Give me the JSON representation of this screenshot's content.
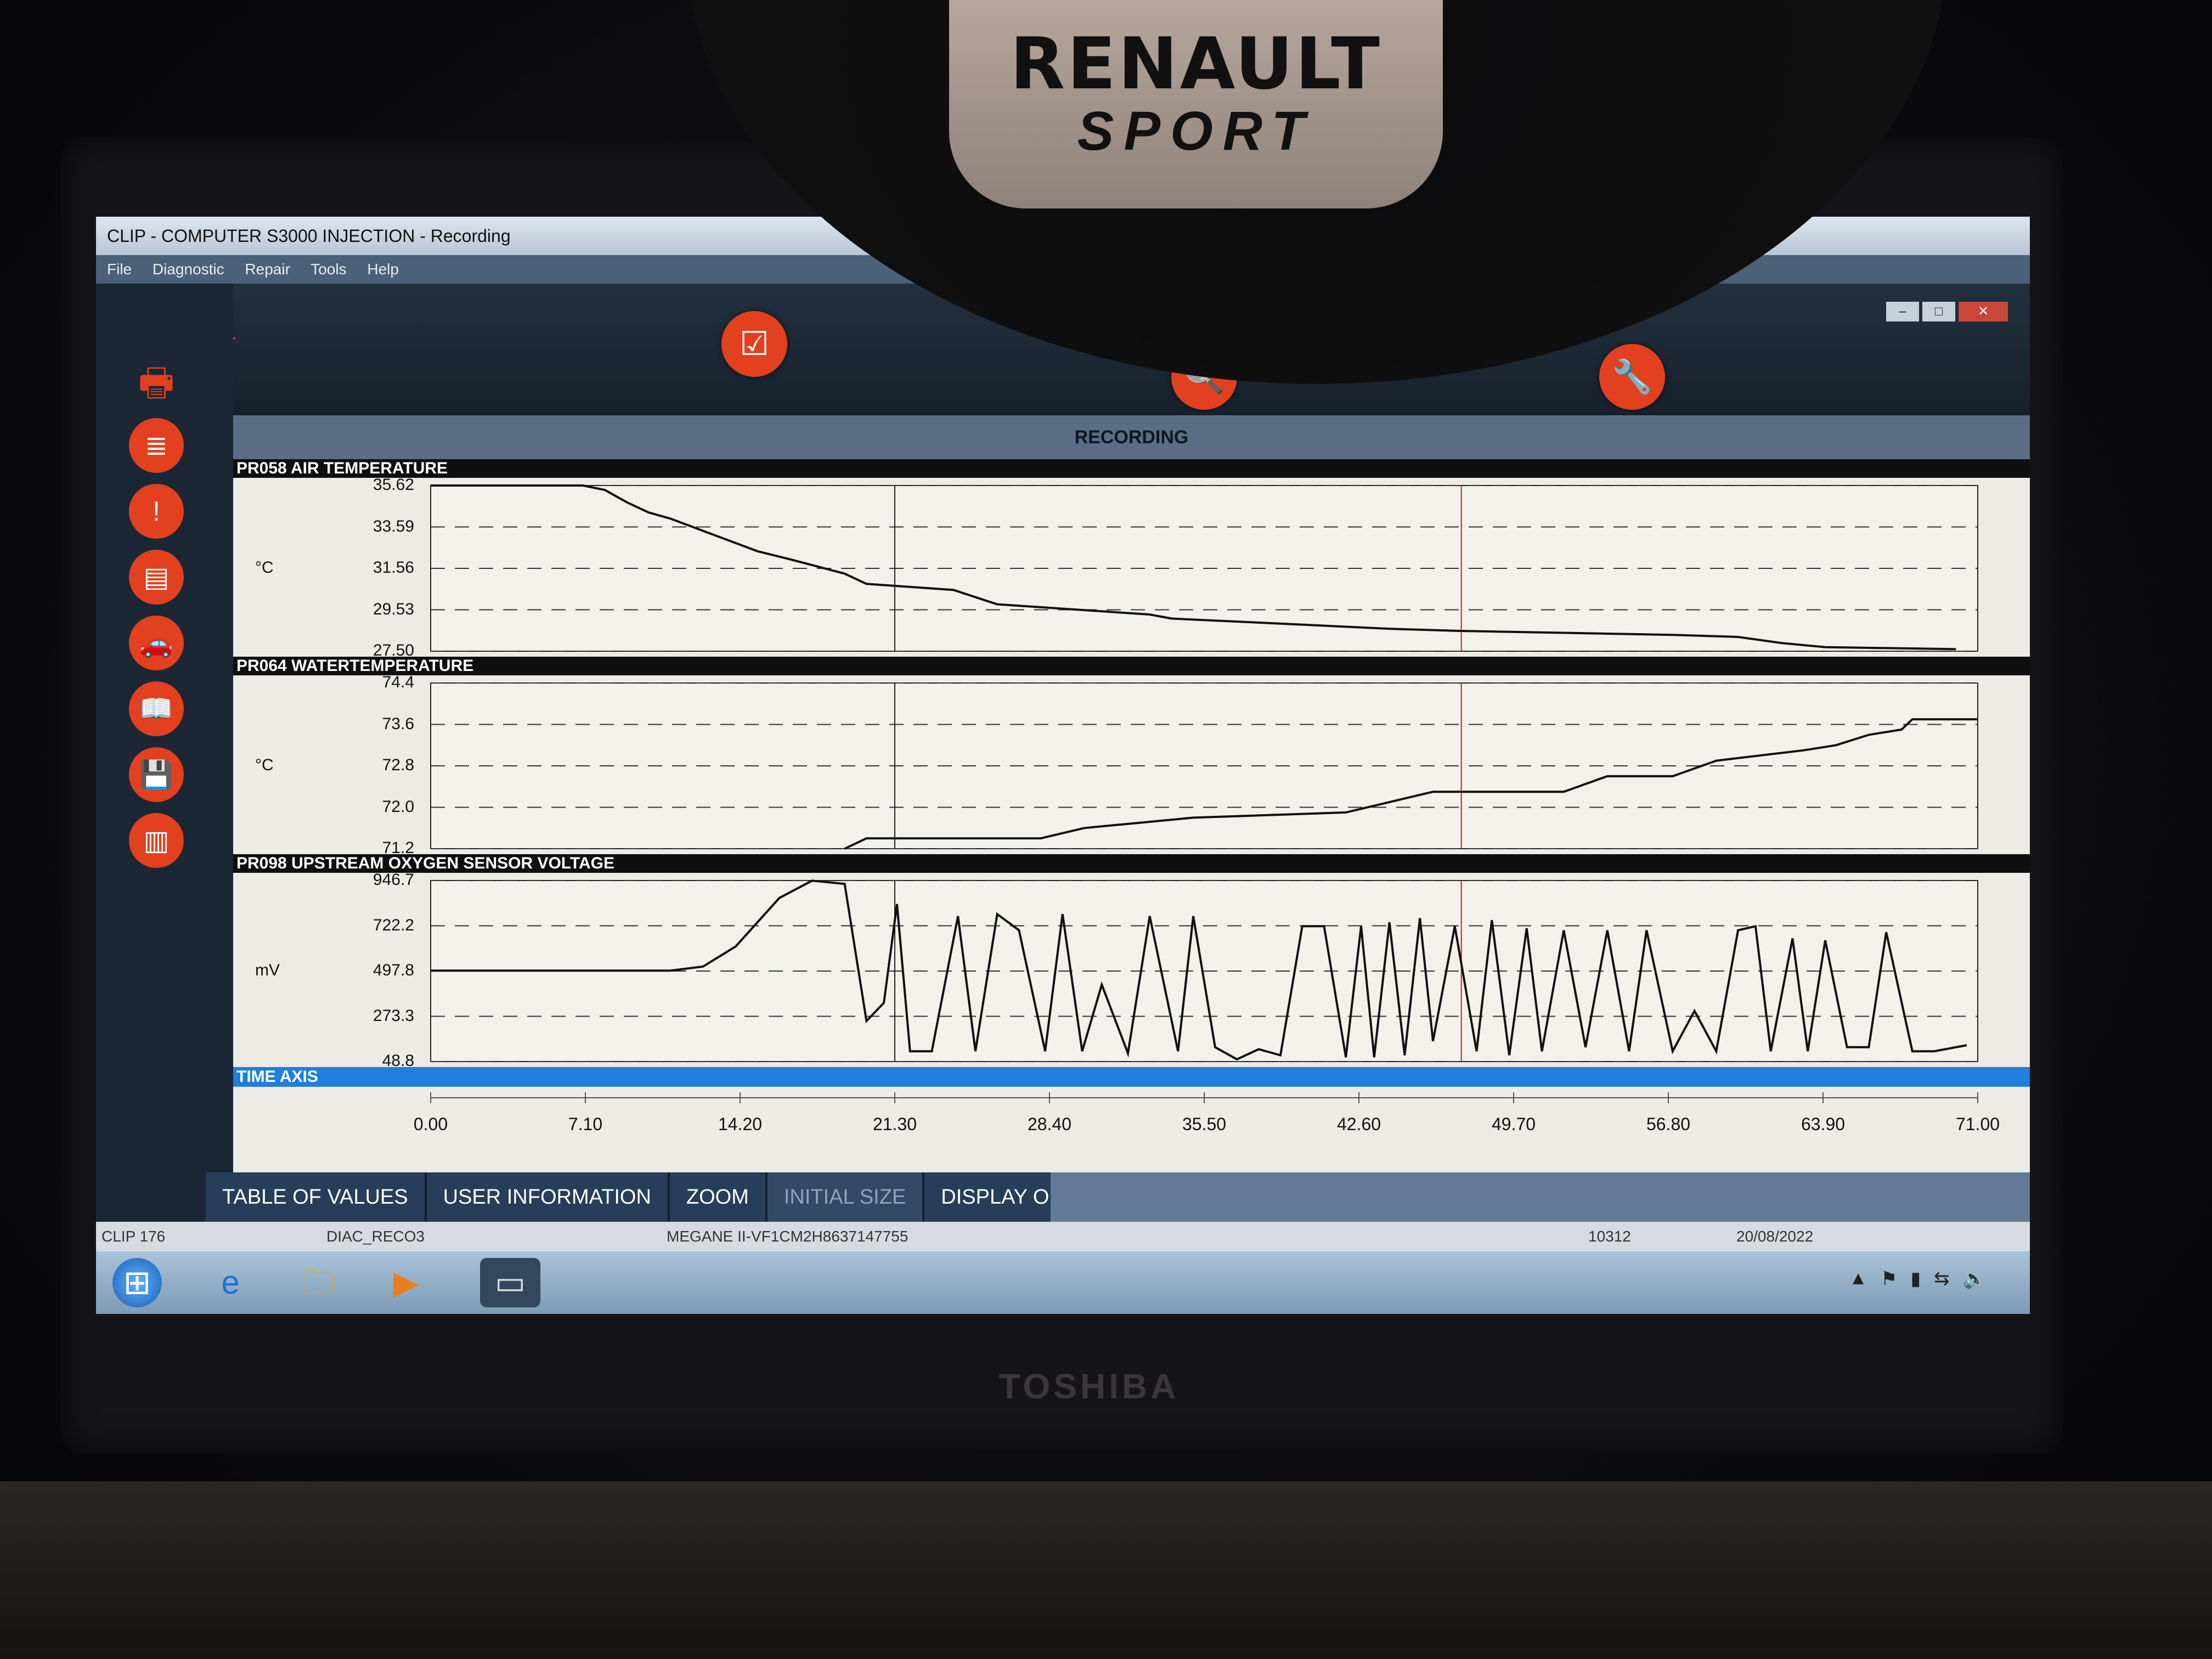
{
  "window": {
    "title": "CLIP - COMPUTER S3000 INJECTION - Recording",
    "menu": [
      "File",
      "Diagnostic",
      "Repair",
      "Tools",
      "Help"
    ],
    "controls": {
      "minimize": "–",
      "maximize": "□",
      "close": "✕"
    }
  },
  "wheel": {
    "brand_line1": "RENAULT",
    "brand_line2": "SPORT"
  },
  "laptop_brand": "TOSHIBA",
  "recording_label": "RECORDING",
  "icons": {
    "back": "←",
    "printer": "🖶",
    "identification": "≣",
    "faults": "!",
    "measures": "▤",
    "vehicle": "🚗",
    "documentation": "📖",
    "vehicle_save": "💾",
    "barcode": "▥",
    "checklist": "☑",
    "search": "🔍",
    "wrench": "🔧"
  },
  "bottom_buttons": [
    {
      "label": "TABLE OF VALUES",
      "enabled": true
    },
    {
      "label": "USER INFORMATION",
      "enabled": true
    },
    {
      "label": "ZOOM",
      "enabled": true
    },
    {
      "label": "INITIAL SIZE",
      "enabled": false
    },
    {
      "label": "DISPLAY ORDER",
      "enabled": true
    }
  ],
  "status": {
    "clip": "CLIP 176",
    "session": "DIAC_RECO3",
    "vehicle": "MEGANE II-VF1CM2H8637147755",
    "code": "10312",
    "date": "20/08/2022"
  },
  "time_axis": {
    "label": "TIME AXIS",
    "ticks": [
      "0.00",
      "7.10",
      "14.20",
      "21.30",
      "28.40",
      "35.50",
      "42.60",
      "49.70",
      "56.80",
      "63.90",
      "71.00"
    ]
  },
  "chart_data": [
    {
      "type": "line",
      "title": "PR058 AIR TEMPERATURE",
      "ylabel": "°C",
      "yticks": [
        "35.62",
        "33.59",
        "31.56",
        "29.53",
        "27.50"
      ],
      "ylim": [
        27.5,
        35.62
      ],
      "xlim": [
        0,
        71
      ],
      "grid": true,
      "x": [
        0,
        7,
        8,
        9,
        10,
        11,
        12.5,
        14,
        15,
        16.5,
        19,
        20,
        24,
        26,
        33,
        34,
        38,
        44,
        47,
        52,
        57,
        60,
        62,
        64,
        70
      ],
      "y": [
        35.62,
        35.62,
        35.4,
        34.8,
        34.3,
        34.0,
        33.4,
        32.8,
        32.4,
        32.0,
        31.3,
        30.8,
        30.5,
        29.8,
        29.3,
        29.1,
        28.9,
        28.6,
        28.5,
        28.4,
        28.3,
        28.2,
        27.9,
        27.7,
        27.6
      ]
    },
    {
      "type": "line",
      "title": "PR064 WATERTEMPERATURE",
      "ylabel": "°C",
      "yticks": [
        "74.4",
        "73.6",
        "72.8",
        "72.0",
        "71.2"
      ],
      "ylim": [
        71.2,
        74.4
      ],
      "xlim": [
        0,
        71
      ],
      "grid": true,
      "x": [
        19,
        20,
        24,
        28,
        30,
        35,
        42,
        44,
        46,
        52,
        54,
        57,
        59,
        61,
        63,
        64.5,
        66,
        67.5,
        68,
        71
      ],
      "y": [
        71.2,
        71.4,
        71.4,
        71.4,
        71.6,
        71.8,
        71.9,
        72.1,
        72.3,
        72.3,
        72.6,
        72.6,
        72.9,
        73.0,
        73.1,
        73.2,
        73.4,
        73.5,
        73.7,
        73.7
      ]
    },
    {
      "type": "line",
      "title": "PR098 UPSTREAM OXYGEN SENSOR VOLTAGE",
      "ylabel": "mV",
      "yticks": [
        "946.7",
        "722.2",
        "497.8",
        "273.3",
        "48.8"
      ],
      "ylim": [
        48.8,
        946.7
      ],
      "xlim": [
        0,
        71
      ],
      "grid": true,
      "x": [
        0,
        11,
        12.5,
        14,
        16,
        17.5,
        19,
        20,
        20.8,
        21.4,
        22,
        23,
        24.2,
        25,
        26,
        27,
        28.2,
        29,
        29.9,
        30.8,
        32,
        33,
        34.3,
        35,
        36,
        37,
        38,
        39,
        40,
        41,
        42,
        42.7,
        43.3,
        44,
        44.7,
        45.4,
        46,
        47,
        48,
        48.7,
        49.5,
        50.3,
        51,
        52,
        53,
        54,
        55,
        55.8,
        57,
        58,
        59,
        60,
        60.8,
        61.5,
        62.5,
        63.2,
        64,
        65,
        66,
        66.8,
        68,
        69,
        70.5
      ],
      "y": [
        500,
        500,
        520,
        620,
        860,
        946,
        930,
        250,
        340,
        830,
        100,
        100,
        770,
        100,
        780,
        700,
        100,
        780,
        100,
        430,
        90,
        770,
        100,
        770,
        120,
        60,
        110,
        80,
        720,
        720,
        70,
        720,
        70,
        740,
        80,
        760,
        150,
        720,
        100,
        750,
        80,
        710,
        100,
        700,
        120,
        700,
        100,
        700,
        100,
        300,
        100,
        700,
        720,
        100,
        660,
        100,
        650,
        120,
        120,
        690,
        100,
        100,
        130
      ]
    }
  ]
}
